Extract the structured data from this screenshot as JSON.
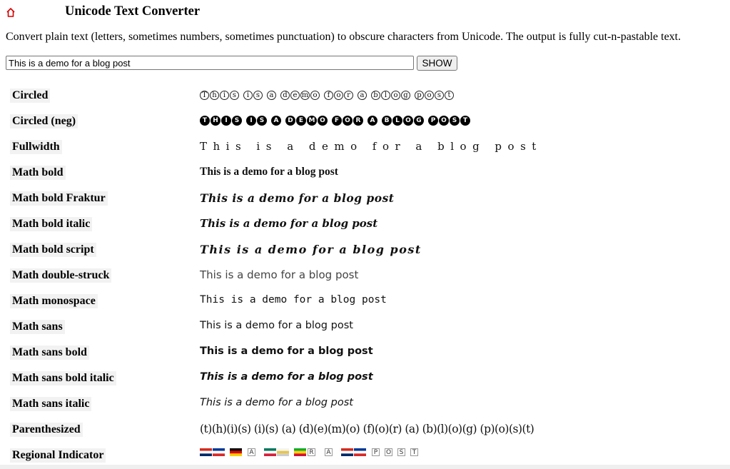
{
  "page": {
    "title": "Unicode Text Converter",
    "description": "Convert plain text (letters, sometimes numbers, sometimes punctuation) to obscure characters from Unicode. The output is fully cut-n-pastable text.",
    "home_icon": "home-icon",
    "accent_color": "#d40000"
  },
  "form": {
    "input_value": "This is a demo for a blog post",
    "show_label": "SHOW"
  },
  "rows": [
    {
      "label": "Circled",
      "style": "circled",
      "output": "This is a demo for a blog post"
    },
    {
      "label": "Circled (neg)",
      "style": "circled-neg",
      "output": "THIS IS A DEMO FOR A BLOG POST"
    },
    {
      "label": "Fullwidth",
      "style": "fullwidth",
      "output": "This is a demo for a blog post"
    },
    {
      "label": "Math bold",
      "style": "math-bold",
      "output": "This is a demo for a blog post"
    },
    {
      "label": "Math bold Fraktur",
      "style": "fraktur",
      "output": "This is a demo for a blog post"
    },
    {
      "label": "Math bold italic",
      "style": "bold-italic",
      "output": "This is a demo for a blog post"
    },
    {
      "label": "Math bold script",
      "style": "bold-script",
      "output": "This is a demo for a blog post"
    },
    {
      "label": "Math double-struck",
      "style": "double-struck",
      "output": "This is a demo for a blog post"
    },
    {
      "label": "Math monospace",
      "style": "monospace",
      "output": "This is a demo for a blog post"
    },
    {
      "label": "Math sans",
      "style": "sans",
      "output": "This is a demo for a blog post"
    },
    {
      "label": "Math sans bold",
      "style": "sans-bold",
      "output": "This is a demo for a blog post"
    },
    {
      "label": "Math sans bold italic",
      "style": "sans-bold-italic",
      "output": "This is a demo for a blog post"
    },
    {
      "label": "Math sans italic",
      "style": "sans-italic",
      "output": "This is a demo for a blog post"
    },
    {
      "label": "Parenthesized",
      "style": "parenthesized",
      "output": "(t)(h)(i)(s) (i)(s) (a) (d)(e)(m)(o) (f)(o)(r) (a) (b)(l)(o)(g) (p)(o)(s)(t)"
    },
    {
      "label": "Regional Indicator",
      "style": "regional",
      "output": "This is a demo for a blog post"
    }
  ]
}
